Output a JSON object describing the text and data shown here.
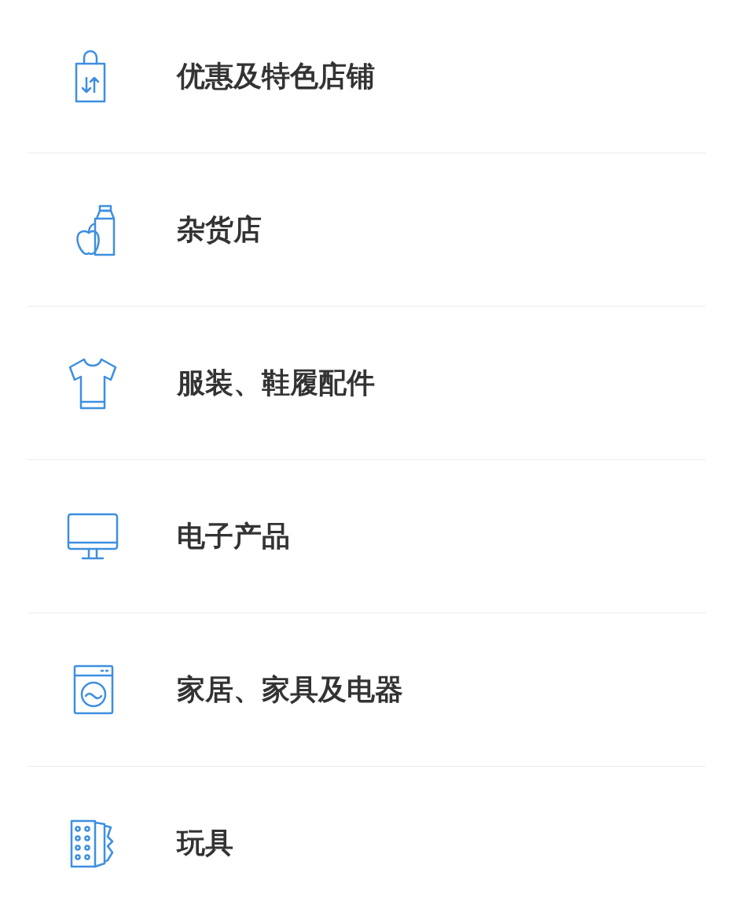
{
  "categories": [
    {
      "label": "优惠及特色店铺"
    },
    {
      "label": "杂货店"
    },
    {
      "label": "服装、鞋履配件"
    },
    {
      "label": "电子产品"
    },
    {
      "label": "家居、家具及电器"
    },
    {
      "label": "玩具"
    }
  ]
}
